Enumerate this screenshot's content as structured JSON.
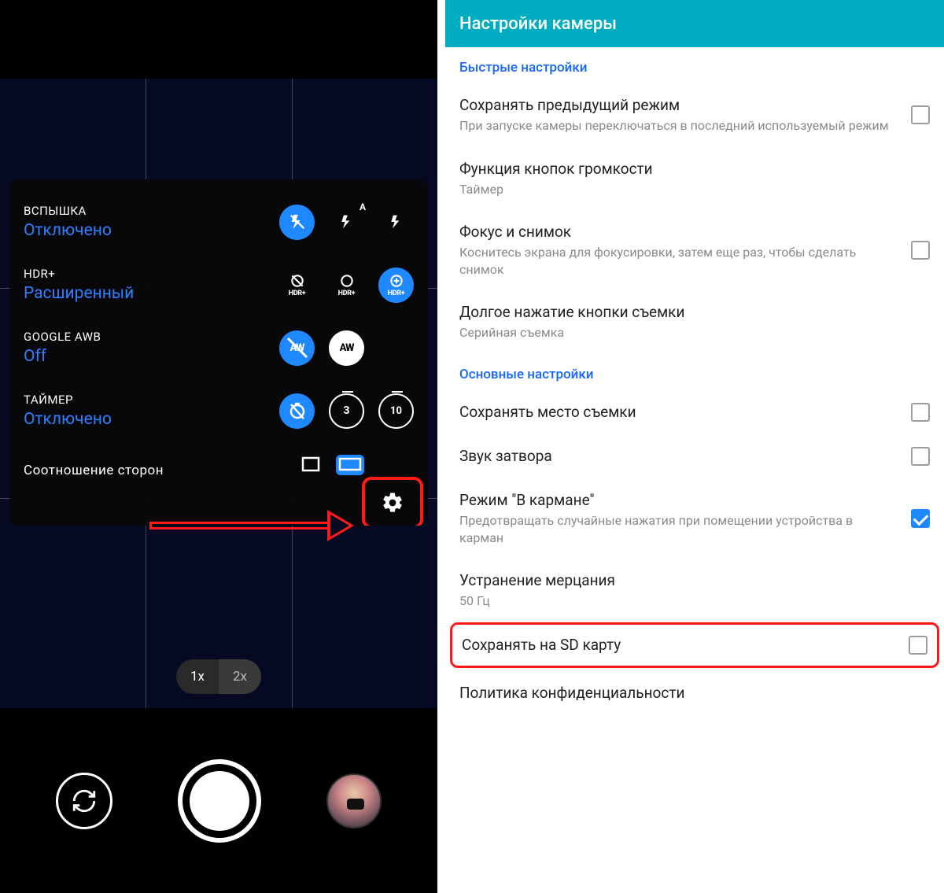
{
  "left": {
    "flash": {
      "label": "ВСПЫШКА",
      "value": "Отключено"
    },
    "hdr": {
      "label": "HDR+",
      "value": "Расширенный",
      "tag": "HDR+"
    },
    "awb": {
      "label": "GOOGLE AWB",
      "value": "Off"
    },
    "timer": {
      "label": "ТАЙМЕР",
      "value": "Отключено",
      "opt3": "3",
      "opt10": "10"
    },
    "aspect": {
      "label": "Соотношение сторон"
    },
    "zoom": {
      "x1": "1x",
      "x2": "2x"
    }
  },
  "right": {
    "header": "Настройки камеры",
    "sec_quick": "Быстрые настройки",
    "sec_main": "Основные настройки",
    "items": {
      "prev_mode": {
        "title": "Сохранять предыдущий режим",
        "sub": "При запуске камеры переключаться в последний используемый режим"
      },
      "vol_keys": {
        "title": "Функция кнопок громкости",
        "sub": "Таймер"
      },
      "focus_shot": {
        "title": "Фокус и снимок",
        "sub": "Коснитесь экрана для фокусировки, затем еще раз, чтобы сделать снимок"
      },
      "long_press": {
        "title": "Долгое нажатие кнопки съемки",
        "sub": "Серийная съемка"
      },
      "save_location": {
        "title": "Сохранять место съемки"
      },
      "shutter_sound": {
        "title": "Звук затвора"
      },
      "pocket_mode": {
        "title": "Режим \"В кармане\"",
        "sub": "Предотвращать случайные нажатия при помещении устройства в карман"
      },
      "flicker": {
        "title": "Устранение мерцания",
        "sub": "50 Гц"
      },
      "save_sd": {
        "title": "Сохранять на SD карту"
      },
      "privacy": {
        "title": "Политика конфиденциальности"
      }
    }
  }
}
